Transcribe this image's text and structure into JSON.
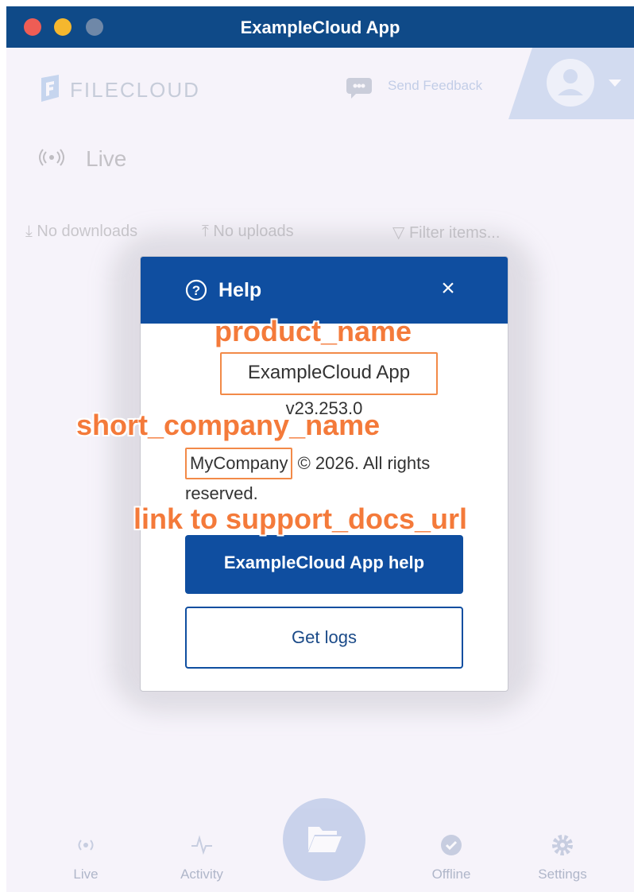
{
  "window": {
    "title": "ExampleCloud App"
  },
  "app": {
    "logo_text": "FILECLOUD",
    "feedback_label": "Send Feedback",
    "section_title": "Live",
    "downloads_label": "No downloads",
    "uploads_label": "No uploads",
    "filter_placeholder": "Filter items..."
  },
  "bottom_nav": {
    "items": [
      {
        "label": "Live",
        "icon": "live-icon"
      },
      {
        "label": "Activity",
        "icon": "activity-icon"
      },
      {
        "label": "Offline",
        "icon": "offline-icon"
      },
      {
        "label": "Settings",
        "icon": "settings-icon"
      }
    ],
    "center_icon": "folder-icon"
  },
  "dialog": {
    "title": "Help",
    "product_name": "ExampleCloud App",
    "version": "v23.253.0",
    "company": "MyCompany",
    "copyright_suffix": "© 2026. All rights reserved.",
    "help_button": "ExampleCloud App help",
    "logs_button": "Get logs"
  },
  "annotations": {
    "product_name": "product_name",
    "short_company_name": "short_company_name",
    "support_link": "link to support_docs_url"
  },
  "colors": {
    "titlebar": "#0f4a88",
    "dialog_header": "#0f4ea0",
    "annotation": "#f47a3a",
    "background": "#f6f3fa"
  }
}
